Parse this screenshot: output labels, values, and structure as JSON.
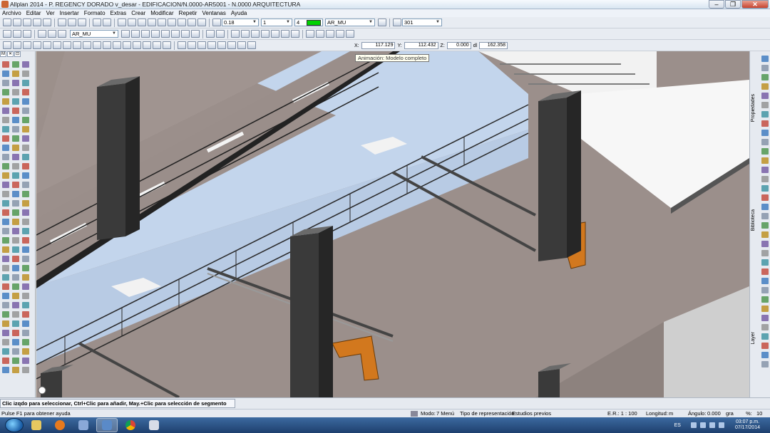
{
  "window": {
    "title": "Allplan 2014 - P. REGENCY DORADO v_desar - EDIFICACION/N.0000-AR5001 - N.0000 ARQUITECTURA",
    "min_label": "–",
    "max_label": "❐",
    "close_label": "✕"
  },
  "menu": [
    "Archivo",
    "Editar",
    "Ver",
    "Insertar",
    "Formato",
    "Extras",
    "Crear",
    "Modificar",
    "Repetir",
    "Ventanas",
    "Ayuda"
  ],
  "toolbar": {
    "pen_value": "0.18",
    "line_value": "1",
    "color_value": "4",
    "layer_value": "AR_MU",
    "layer_value2": "AR_MU",
    "pattern_value": "301"
  },
  "coords": {
    "x_label": "X:",
    "x_value": "117.129",
    "y_label": "Y:",
    "y_value": "112.432",
    "z_label": "Z:",
    "z_value": "0.000",
    "dl_label": "dl",
    "dl_value": "162.358"
  },
  "tooltip": "Animación: Modelo completo",
  "left_header": [
    "M",
    "✕",
    "⊡"
  ],
  "right_tabs": [
    "Propiedades",
    "Biblioteca",
    "Layer"
  ],
  "hint": "Clic izqdo para seleccionar, Ctrl+Clic para añadir, May.+Clic para selección de segmento",
  "status": {
    "help": "Pulse F1 para obtener ayuda",
    "mode_label": "Modo:",
    "mode_value": "7 Menú",
    "rep_label": "Tipo de representación:",
    "rep_value": "Estudios previos",
    "scale_label": "E.R.: 1 : 100",
    "length_label": "Longitud:",
    "length_value": "m",
    "angle_label": "Ángulo:",
    "angle_value": "0.000",
    "unit_value": "gra",
    "pct_label": "%:",
    "pct_value": "10"
  },
  "taskbar": {
    "lang": "ES",
    "time": "03:07 p.m.",
    "date": "07/17/2014"
  },
  "colors": {
    "viewport_floor": "#9b8f8b",
    "sky": "#c7d9ee",
    "chair_orange": "#d2781e",
    "column": "#3a3a3a"
  }
}
